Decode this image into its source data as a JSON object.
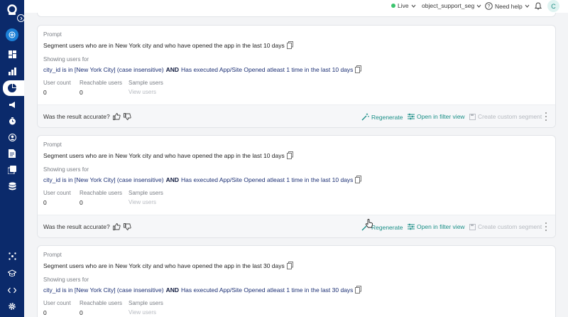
{
  "colors": {
    "sidebar": "#0b2a6b",
    "accent": "#1a8f87",
    "live": "#3cc46e",
    "add_button": "#1b7fd6"
  },
  "topbar": {
    "live_label": "Live",
    "app_selector": "object_support_seg",
    "help_label": "Need help",
    "avatar_initial": "C"
  },
  "sidebar": {
    "items": [
      "logo-icon",
      "expand-icon",
      "add-icon",
      "dashboard-icon",
      "analytics-icon",
      "segments-icon",
      "campaigns-icon",
      "flows-icon",
      "users-icon",
      "reports-icon",
      "templates-icon",
      "data-icon",
      "integrations-icon",
      "academy-icon",
      "developer-icon",
      "settings-icon"
    ]
  },
  "results": [
    {
      "prompt_label": "Prompt",
      "prompt": "Segment users who are in New York city and who have opened the app in the last 10 days",
      "showing_label": "Showing users for",
      "query_prefix": "city_id is in [New York City] (case insensitive)",
      "query_and": "AND",
      "query_suffix": "Has executed App/Site Opened atleast 1 time in the last 10 days",
      "user_count_label": "User count",
      "user_count": "0",
      "reachable_label": "Reachable users",
      "reachable": "0",
      "sample_label": "Sample users",
      "view_users": "View users",
      "accurate_q": "Was the result accurate?",
      "regenerate": "Regenerate",
      "open_filter": "Open in filter view",
      "create_segment": "Create custom segment"
    },
    {
      "prompt_label": "Prompt",
      "prompt": "Segment users who are in New York city and who have opened the app in the last 10 days",
      "showing_label": "Showing users for",
      "query_prefix": "city_id is in [New York City] (case insensitive)",
      "query_and": "AND",
      "query_suffix": "Has executed App/Site Opened atleast 1 time in the last 10 days",
      "user_count_label": "User count",
      "user_count": "0",
      "reachable_label": "Reachable users",
      "reachable": "0",
      "sample_label": "Sample users",
      "view_users": "View users",
      "accurate_q": "Was the result accurate?",
      "regenerate": "Regenerate",
      "open_filter": "Open in filter view",
      "create_segment": "Create custom segment"
    },
    {
      "prompt_label": "Prompt",
      "prompt": "Segment users who are in New York city and who have opened the app in the last 30 days",
      "showing_label": "Showing users for",
      "query_prefix": "city_id is in [New York City] (case insensitive)",
      "query_and": "AND",
      "query_suffix": "Has executed App/Site Opened atleast 1 time in the last 30 days",
      "user_count_label": "User count",
      "user_count": "0",
      "reachable_label": "Reachable users",
      "reachable": "0",
      "sample_label": "Sample users",
      "view_users": "View users"
    }
  ]
}
